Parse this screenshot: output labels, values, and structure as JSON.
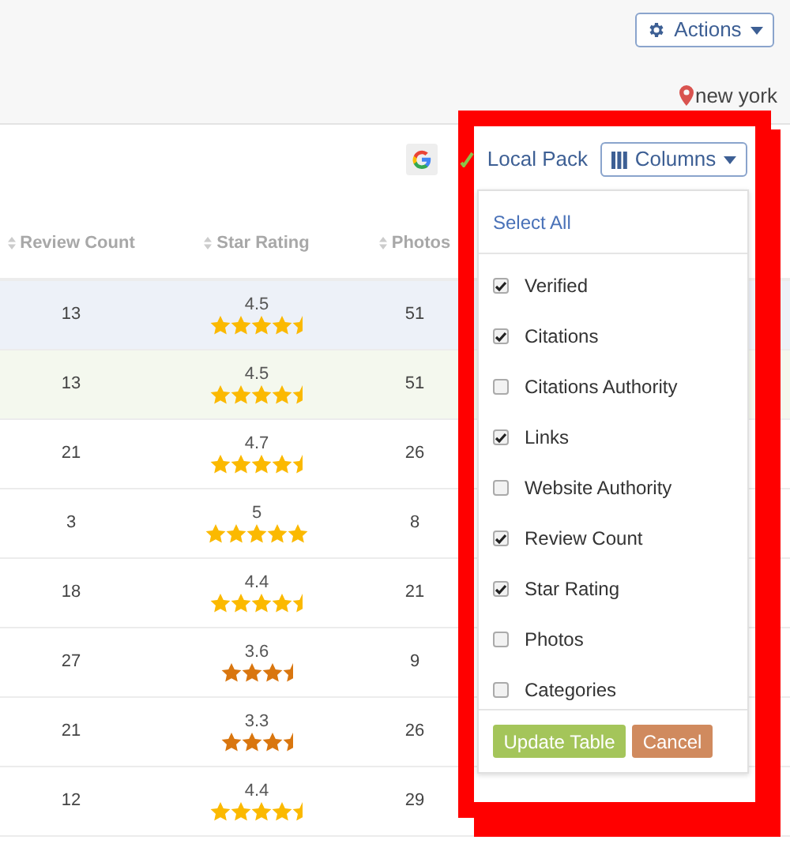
{
  "header": {
    "actions_button": "Actions",
    "location": "new york"
  },
  "table_toolbar": {
    "source_label": "Local Pack",
    "columns_button": "Columns"
  },
  "table": {
    "columns": [
      "Review Count",
      "Star Rating",
      "Photos"
    ],
    "rows": [
      {
        "review_count": "13",
        "rating": "4.5",
        "stars": 4,
        "half_star": true,
        "photos": "51",
        "color": "#edf1f8"
      },
      {
        "review_count": "13",
        "rating": "4.5",
        "stars": 4,
        "half_star": true,
        "photos": "51",
        "color": "#f4f8ee"
      },
      {
        "review_count": "21",
        "rating": "4.7",
        "stars": 4,
        "half_star": true,
        "photos": "26",
        "color": "#ffffff"
      },
      {
        "review_count": "3",
        "rating": "5",
        "stars": 5,
        "photos": "8",
        "color": "#ffffff"
      },
      {
        "review_count": "18",
        "rating": "4.4",
        "stars": 4,
        "half_star": true,
        "photos": "21",
        "color": "#ffffff"
      },
      {
        "review_count": "27",
        "rating": "3.6",
        "stars": 3,
        "half_star": true,
        "photos": "9",
        "color": "#ffffff"
      },
      {
        "review_count": "21",
        "rating": "3.3",
        "stars": 3,
        "half_star": true,
        "photos": "26",
        "color": "#ffffff"
      },
      {
        "review_count": "12",
        "rating": "4.4",
        "stars": 4,
        "half_star": true,
        "photos": "29",
        "color": "#ffffff"
      }
    ]
  },
  "column_menu": {
    "select_all": "Select All",
    "options": [
      {
        "label": "Verified",
        "checked": true
      },
      {
        "label": "Citations",
        "checked": true
      },
      {
        "label": "Citations Authority",
        "checked": false
      },
      {
        "label": "Links",
        "checked": true
      },
      {
        "label": "Website Authority",
        "checked": false
      },
      {
        "label": "Review Count",
        "checked": true
      },
      {
        "label": "Star Rating",
        "checked": true
      },
      {
        "label": "Photos",
        "checked": false
      },
      {
        "label": "Categories",
        "checked": false
      }
    ],
    "buttons": [
      {
        "label": "Update Table",
        "kind": "primary"
      },
      {
        "label": "Cancel",
        "kind": "cancel"
      }
    ]
  }
}
